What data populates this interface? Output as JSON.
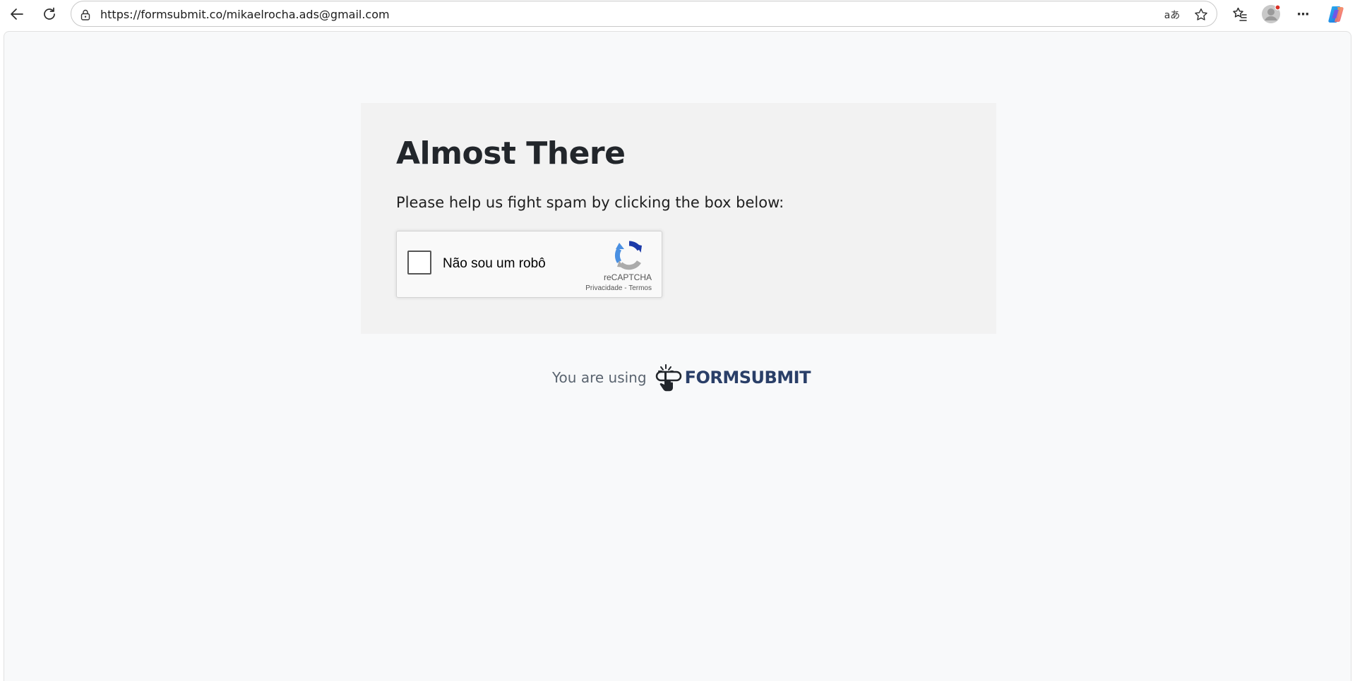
{
  "browser": {
    "url": "https://formsubmit.co/mikaelrocha.ads@gmail.com",
    "icons": {
      "back": "back-arrow-icon",
      "reload": "reload-icon",
      "site_info": "lock-icon",
      "translate": "translate-icon",
      "favorite": "star-icon",
      "favorites": "favorites-icon",
      "profile": "profile-icon",
      "more": "more-icon",
      "copilot": "copilot-icon"
    },
    "translate_glyph": "aあ",
    "more_glyph": "···"
  },
  "page": {
    "title": "Almost There",
    "subtitle": "Please help us fight spam by clicking the box below:",
    "captcha": {
      "label": "Não sou um robô",
      "brand": "reCAPTCHA",
      "privacy_link": "Privacidade",
      "separator": " - ",
      "terms_link": "Termos"
    },
    "footer": {
      "text": "You are using",
      "brand": "FORMSUBMIT"
    }
  },
  "colors": {
    "page_bg": "#f8f9fa",
    "card_bg": "#f2f2f2",
    "brand": "#2a3f68",
    "recaptcha_blue": "#1c3aa9",
    "recaptcha_light_blue": "#4a90e2",
    "recaptcha_gray": "#ababab",
    "notification_dot": "#d93025"
  }
}
